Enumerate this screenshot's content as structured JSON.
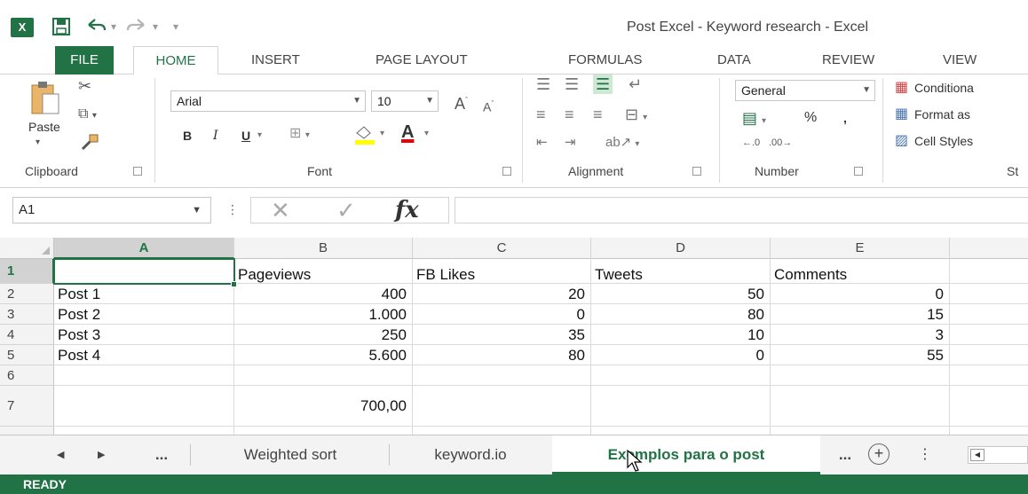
{
  "window": {
    "title": "Post Excel - Keyword research - Excel",
    "app_icon": "excel-icon",
    "accent_color": "#217346"
  },
  "ribbon_tabs": [
    "FILE",
    "HOME",
    "INSERT",
    "PAGE LAYOUT",
    "FORMULAS",
    "DATA",
    "REVIEW",
    "VIEW"
  ],
  "ribbon": {
    "clipboard": {
      "paste_label": "Paste",
      "group_label": "Clipboard"
    },
    "font": {
      "font_name": "Arial",
      "font_size": "10",
      "bold": "B",
      "italic": "I",
      "underline": "U",
      "font_color_letter": "A",
      "group_label": "Font"
    },
    "alignment": {
      "group_label": "Alignment"
    },
    "number": {
      "format": "General",
      "percent": "%",
      "comma": ",",
      "group_label": "Number"
    },
    "styles": {
      "conditional": "Conditiona",
      "format_as": "Format as ",
      "cell_styles": "Cell Styles",
      "group_label": "St"
    }
  },
  "formula_bar": {
    "name_box": "A1",
    "fx_label": "fx",
    "formula": ""
  },
  "sheet": {
    "columns": [
      "A",
      "B",
      "C",
      "D",
      "E"
    ],
    "row_numbers": [
      "1",
      "2",
      "3",
      "4",
      "5",
      "6",
      "7"
    ],
    "rows": [
      [
        "",
        "Pageviews",
        "FB Likes",
        "Tweets",
        "Comments"
      ],
      [
        "Post 1",
        "400",
        "20",
        "50",
        "0"
      ],
      [
        "Post 2",
        "1.000",
        "0",
        "80",
        "15"
      ],
      [
        "Post 3",
        "250",
        "35",
        "10",
        "3"
      ],
      [
        "Post 4",
        "5.600",
        "80",
        "0",
        "55"
      ],
      [
        "",
        "",
        "",
        "",
        ""
      ],
      [
        "",
        "700,00",
        "",
        "",
        ""
      ]
    ],
    "active_cell": "A1"
  },
  "sheet_tabs": {
    "ellipsis_left": "...",
    "tabs": [
      "Weighted sort",
      "keyword.io",
      "Exemplos para o post"
    ],
    "active_tab": "Exemplos para o post",
    "ellipsis_right": "...",
    "add_sheet": "+"
  },
  "status": "READY"
}
